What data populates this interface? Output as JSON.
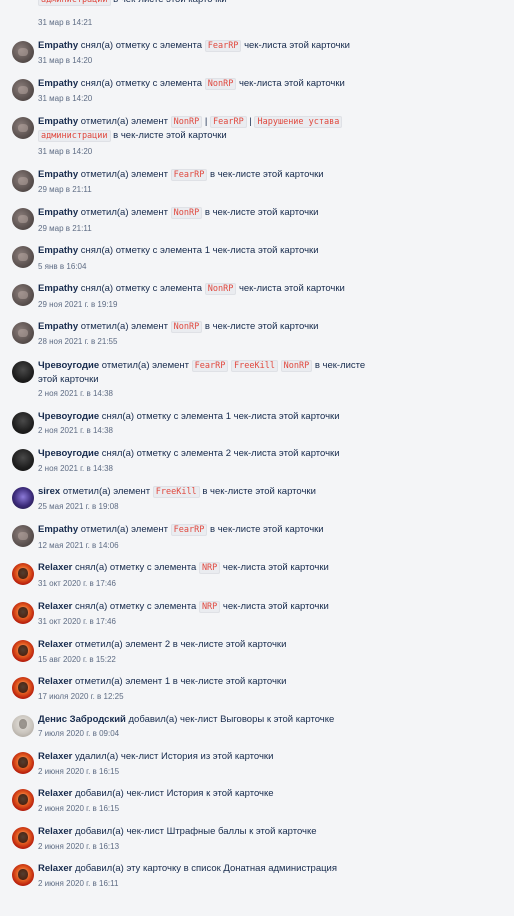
{
  "activity": [
    {
      "user": "",
      "avatar": "none",
      "parts": [
        {
          "code": "администрации"
        },
        {
          "t": " в чек-листе этой карточки"
        }
      ],
      "date": "31 мар в 14:21"
    },
    {
      "user": "Empathy",
      "avatar": "empathy",
      "parts": [
        {
          "t": " снял(а) отметку с элемента "
        },
        {
          "code": "FearRP"
        },
        {
          "t": " чек-листа этой карточки"
        }
      ],
      "date": "31 мар в 14:20"
    },
    {
      "user": "Empathy",
      "avatar": "empathy",
      "parts": [
        {
          "t": " снял(а) отметку с элемента "
        },
        {
          "code": "NonRP"
        },
        {
          "t": " чек-листа этой карточки"
        }
      ],
      "date": "31 мар в 14:20"
    },
    {
      "user": "Empathy",
      "avatar": "empathy",
      "parts": [
        {
          "t": " отметил(а) элемент "
        },
        {
          "code": "NonRP"
        },
        {
          "t": " | "
        },
        {
          "code": "FearRP"
        },
        {
          "t": " | "
        },
        {
          "code": "Нарушение устава"
        },
        {
          "t": " "
        },
        {
          "code": "администрации"
        },
        {
          "t": " в чек-листе этой карточки"
        }
      ],
      "date": "31 мар в 14:20"
    },
    {
      "user": "Empathy",
      "avatar": "empathy",
      "parts": [
        {
          "t": " отметил(а) элемент "
        },
        {
          "code": "FearRP"
        },
        {
          "t": " в чек-листе этой карточки"
        }
      ],
      "date": "29 мар в 21:11"
    },
    {
      "user": "Empathy",
      "avatar": "empathy",
      "parts": [
        {
          "t": " отметил(а) элемент "
        },
        {
          "code": "NonRP"
        },
        {
          "t": " в чек-листе этой карточки"
        }
      ],
      "date": "29 мар в 21:11"
    },
    {
      "user": "Empathy",
      "avatar": "empathy",
      "parts": [
        {
          "t": " снял(а) отметку с элемента 1 чек-листа этой карточки"
        }
      ],
      "date": "5 янв в 16:04"
    },
    {
      "user": "Empathy",
      "avatar": "empathy",
      "parts": [
        {
          "t": " снял(а) отметку с элемента "
        },
        {
          "code": "NonRP"
        },
        {
          "t": " чек-листа этой карточки"
        }
      ],
      "date": "29 ноя 2021 г. в 19:19"
    },
    {
      "user": "Empathy",
      "avatar": "empathy",
      "parts": [
        {
          "t": " отметил(а) элемент "
        },
        {
          "code": "NonRP"
        },
        {
          "t": " в чек-листе этой карточки"
        }
      ],
      "date": "28 ноя 2021 г. в 21:55"
    },
    {
      "user": "Чревоугодие",
      "avatar": "chrev",
      "parts": [
        {
          "t": " отметил(а) элемент "
        },
        {
          "code": "FearRP"
        },
        {
          "t": " "
        },
        {
          "code": "FreeKill"
        },
        {
          "t": " "
        },
        {
          "code": "NonRP"
        },
        {
          "t": " в чек-листе этой карточки"
        }
      ],
      "date": "2 ноя 2021 г. в 14:38"
    },
    {
      "user": "Чревоугодие",
      "avatar": "chrev",
      "parts": [
        {
          "t": " снял(а) отметку с элемента 1 чек-листа этой карточки"
        }
      ],
      "date": "2 ноя 2021 г. в 14:38"
    },
    {
      "user": "Чревоугодие",
      "avatar": "chrev",
      "parts": [
        {
          "t": " снял(а) отметку с элемента 2 чек-листа этой карточки"
        }
      ],
      "date": "2 ноя 2021 г. в 14:38"
    },
    {
      "user": "sirex",
      "avatar": "sirex",
      "parts": [
        {
          "t": " отметил(а) элемент "
        },
        {
          "code": "FreeKill"
        },
        {
          "t": " в чек-листе этой карточки"
        }
      ],
      "date": "25 мая 2021 г. в 19:08"
    },
    {
      "user": "Empathy",
      "avatar": "empathy",
      "parts": [
        {
          "t": " отметил(а) элемент "
        },
        {
          "code": "FearRP"
        },
        {
          "t": " в чек-листе этой карточки"
        }
      ],
      "date": "12 мая 2021 г. в 14:06"
    },
    {
      "user": "Relaxer",
      "avatar": "relaxer",
      "parts": [
        {
          "t": " снял(а) отметку с элемента "
        },
        {
          "code": "NRP"
        },
        {
          "t": " чек-листа этой карточки"
        }
      ],
      "date": "31 окт 2020 г. в 17:46"
    },
    {
      "user": "Relaxer",
      "avatar": "relaxer",
      "parts": [
        {
          "t": " снял(а) отметку с элемента "
        },
        {
          "code": "NRP"
        },
        {
          "t": " чек-листа этой карточки"
        }
      ],
      "date": "31 окт 2020 г. в 17:46"
    },
    {
      "user": "Relaxer",
      "avatar": "relaxer",
      "parts": [
        {
          "t": " отметил(а) элемент 2 в чек-листе этой карточки"
        }
      ],
      "date": "15 авг 2020 г. в 15:22"
    },
    {
      "user": "Relaxer",
      "avatar": "relaxer",
      "parts": [
        {
          "t": " отметил(а) элемент 1 в чек-листе этой карточки"
        }
      ],
      "date": "17 июля 2020 г. в 12:25"
    },
    {
      "user": "Денис Забродский",
      "avatar": "denis",
      "parts": [
        {
          "t": " добавил(а) чек-лист Выговоры к этой карточке"
        }
      ],
      "date": "7 июля 2020 г. в 09:04"
    },
    {
      "user": "Relaxer",
      "avatar": "relaxer",
      "parts": [
        {
          "t": " удалил(а) чек-лист История из этой карточки"
        }
      ],
      "date": "2 июня 2020 г. в 16:15"
    },
    {
      "user": "Relaxer",
      "avatar": "relaxer",
      "parts": [
        {
          "t": " добавил(а) чек-лист История к этой карточке"
        }
      ],
      "date": "2 июня 2020 г. в 16:15"
    },
    {
      "user": "Relaxer",
      "avatar": "relaxer",
      "parts": [
        {
          "t": " добавил(а) чек-лист Штрафные баллы к этой карточке"
        }
      ],
      "date": "2 июня 2020 г. в 16:13"
    },
    {
      "user": "Relaxer",
      "avatar": "relaxer",
      "parts": [
        {
          "t": " добавил(а) эту карточку в список Донатная администрация"
        }
      ],
      "date": "2 июня 2020 г. в 16:11"
    }
  ]
}
